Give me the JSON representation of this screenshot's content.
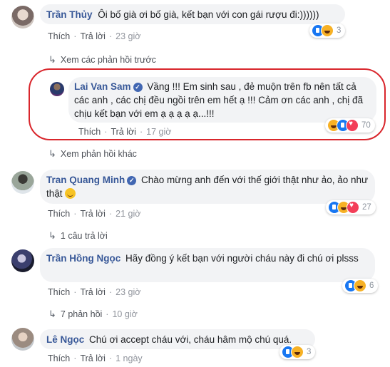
{
  "comments": [
    {
      "name": "Trần Thủy",
      "text": "Ôi bố già ơi bố già, kết bạn với con gái rượu đi:))))))",
      "like_label": "Thích",
      "reply_label": "Trả lời",
      "time": "23 giờ",
      "reaction_count": "3"
    },
    {
      "name": "Lai Van Sam",
      "text": "Vầng !!! Em sinh sau , đẻ muộn trên fb nên tất cả các anh , các chị đều ngồi trên em hết ạ !!! Cảm ơn các anh , chị đã chịu kết bạn với em ạ ạ ạ ạ ạ...!!!",
      "like_label": "Thích",
      "reply_label": "Trả lời",
      "time": "17 giờ",
      "reaction_count": "70"
    },
    {
      "name": "Tran Quang Minh",
      "text": "Chào mừng anh đến với thế giới thật như ảo, ảo như thật",
      "like_label": "Thích",
      "reply_label": "Trả lời",
      "time": "21 giờ",
      "reaction_count": "27"
    },
    {
      "name": "Trần Hồng Ngọc",
      "text": "Hãy đồng ý kết bạn với người cháu này đi chú ơi plsss",
      "like_label": "Thích",
      "reply_label": "Trả lời",
      "time": "23 giờ",
      "reaction_count": "6"
    },
    {
      "name": "Lê Ngọc",
      "text": "Chú ơi accept cháu với, cháu hâm mộ chú quá.",
      "like_label": "Thích",
      "reply_label": "Trả lời",
      "time": "1 ngày",
      "reaction_count": "3"
    }
  ],
  "links": {
    "previous_replies": "Xem các phản hồi trước",
    "other_replies": "Xem phản hồi khác",
    "one_reply": "1 câu trả lời",
    "seven_replies": "7 phản hồi",
    "seven_replies_time": "10 giờ"
  },
  "colors": {
    "name_link": "#385898",
    "bubble_bg": "#f2f3f5",
    "highlight_border": "#d9262c",
    "like_blue": "#1877f2"
  },
  "icons": [
    "reply-arrow-icon",
    "verified-badge-icon",
    "like-reaction-icon",
    "haha-reaction-icon",
    "love-reaction-icon",
    "wow-reaction-icon",
    "smile-emoji-icon"
  ]
}
